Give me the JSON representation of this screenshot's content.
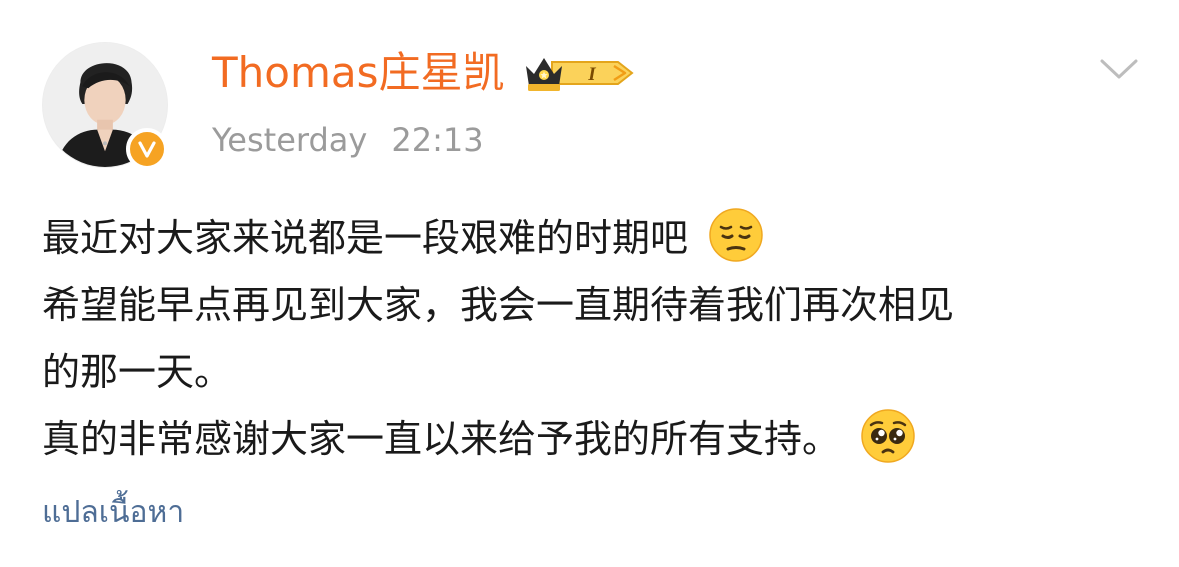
{
  "post": {
    "author": {
      "name": "Thomas庄星凯",
      "avatar": "avatar-photo",
      "verified_icon": "verified-v-icon",
      "badge_level": "I",
      "name_color": "#f26b22",
      "badge_color": "#f6a323"
    },
    "timestamp": {
      "day": "Yesterday",
      "time": "22:13"
    },
    "menu_icon": "chevron-down-icon",
    "content": {
      "line1": "最近对大家来说都是一段艰难的时期吧",
      "line1_emoji": "pensive-face-emoji",
      "line2": "希望能早点再见到大家，我会一直期待着我们再次相见",
      "line3": "的那一天。",
      "line4": "真的非常感谢大家一直以来给予我的所有支持。",
      "line4_emoji": "pleading-face-emoji"
    },
    "translate_label": "แปลเนื้อหา",
    "link_color": "#4e6d95"
  }
}
